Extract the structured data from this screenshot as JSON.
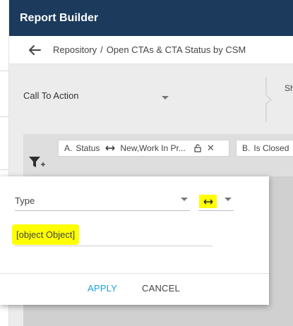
{
  "header": {
    "title": "Report Builder"
  },
  "breadcrumb": {
    "root": "Repository",
    "separator": "/",
    "current": "Open CTAs & CTA Status by CSM"
  },
  "source": {
    "object_label": "Call To Action",
    "next_partial": "Sh"
  },
  "filters": [
    {
      "letter": "A.",
      "field": "Status",
      "value": "New,Work In Pr...",
      "close": "✕"
    },
    {
      "letter": "B.",
      "field": "Is Closed"
    }
  ],
  "popup": {
    "field_value": "Type",
    "value_text": "[object Object]",
    "apply_label": "APPLY",
    "cancel_label": "CANCEL"
  },
  "colors": {
    "header_bg": "#1b3a5c",
    "highlight": "#ffff00",
    "accent": "#1e9fd6"
  },
  "icons": {
    "back": "back-arrow-icon",
    "filter": "filter-add-icon",
    "operator": "double-arrow-icon",
    "lock": "lock-open-icon",
    "close": "close-icon",
    "dropdown": "caret-down-icon"
  }
}
